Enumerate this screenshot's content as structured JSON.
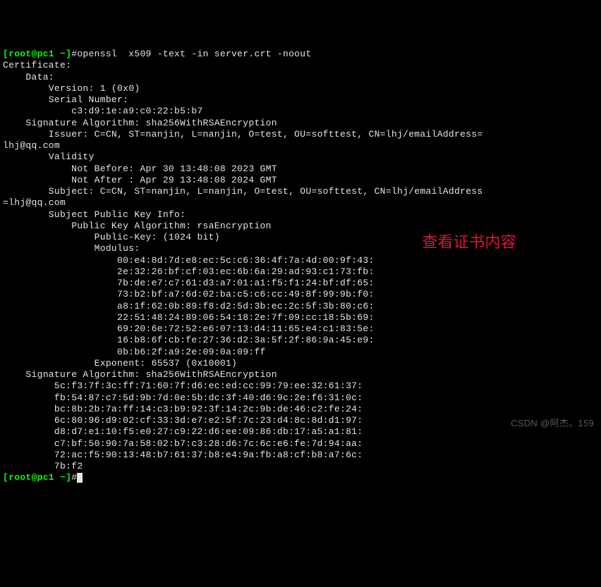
{
  "prompt1": {
    "user_host": "[root@pc1 ~]",
    "symbol": "#",
    "command": "openssl  x509 -text -in server.crt -noout"
  },
  "output": {
    "l1": "Certificate:",
    "l2": "    Data:",
    "l3": "        Version: 1 (0x0)",
    "l4": "        Serial Number:",
    "l5": "            c3:d9:1e:a9:c0:22:b5:b7",
    "l6": "    Signature Algorithm: sha256WithRSAEncryption",
    "l7": "        Issuer: C=CN, ST=nanjin, L=nanjin, O=test, OU=softtest, CN=lhj/emailAddress=",
    "l8": "lhj@qq.com",
    "l9": "        Validity",
    "l10": "            Not Before: Apr 30 13:48:08 2023 GMT",
    "l11": "            Not After : Apr 29 13:48:08 2024 GMT",
    "l12": "        Subject: C=CN, ST=nanjin, L=nanjin, O=test, OU=softtest, CN=lhj/emailAddress",
    "l13": "=lhj@qq.com",
    "l14": "        Subject Public Key Info:",
    "l15": "            Public Key Algorithm: rsaEncryption",
    "l16": "                Public-Key: (1024 bit)",
    "l17": "                Modulus:",
    "l18": "                    00:e4:8d:7d:e8:ec:5c:c6:36:4f:7a:4d:00:9f:43:",
    "l19": "                    2e:32:26:bf:cf:03:ec:6b:6a:29:ad:93:c1:73:fb:",
    "l20": "                    7b:de:e7:c7:61:d3:a7:01:a1:f5:f1:24:bf:df:65:",
    "l21": "                    73:b2:bf:a7:6d:02:ba:c5:c6:cc:49:8f:99:9b:f0:",
    "l22": "                    a8:1f:62:0b:89:f8:d2:5d:3b:ec:2c:5f:3b:80:c6:",
    "l23": "                    22:51:48:24:89:06:54:18:2e:7f:09:cc:18:5b:69:",
    "l24": "                    69:20:6e:72:52:e6:07:13:d4:11:65:e4:c1:83:5e:",
    "l25": "                    16:b8:6f:cb:fe:27:36:d2:3a:5f:2f:86:9a:45:e9:",
    "l26": "                    0b:b6:2f:a9:2e:09:0a:09:ff",
    "l27": "                Exponent: 65537 (0x10001)",
    "l28": "    Signature Algorithm: sha256WithRSAEncryption",
    "l29": "         5c:f3:7f:3c:ff:71:60:7f:d6:ec:ed:cc:99:79:ee:32:61:37:",
    "l30": "         fb:54:87:c7:5d:9b:7d:0e:5b:dc:3f:40:d6:9c:2e:f6:31:0c:",
    "l31": "         bc:8b:2b:7a:ff:14:c3:b9:92:3f:14:2c:9b:de:46:c2:fe:24:",
    "l32": "         6c:80:96:d9:02:cf:33:3d:e7:e2:5f:7c:23:d4:8c:8d:d1:97:",
    "l33": "         d8:d7:e1:10:f5:e0:27:c9:22:d6:ee:09:86:db:17:a5:a1:81:",
    "l34": "         c7:bf:50:90:7a:58:02:b7:c3:28:d6:7c:6c:e6:fe:7d:94:aa:",
    "l35": "         72:ac:f5:90:13:48:b7:61:37:b8:e4:9a:fb:a8:cf:b8:a7:6c:",
    "l36": "         7b:f2"
  },
  "prompt2": {
    "user_host": "[root@pc1 ~]",
    "symbol": "#"
  },
  "annotation": "查看证书内容",
  "watermark": "CSDN @阿杰。159"
}
